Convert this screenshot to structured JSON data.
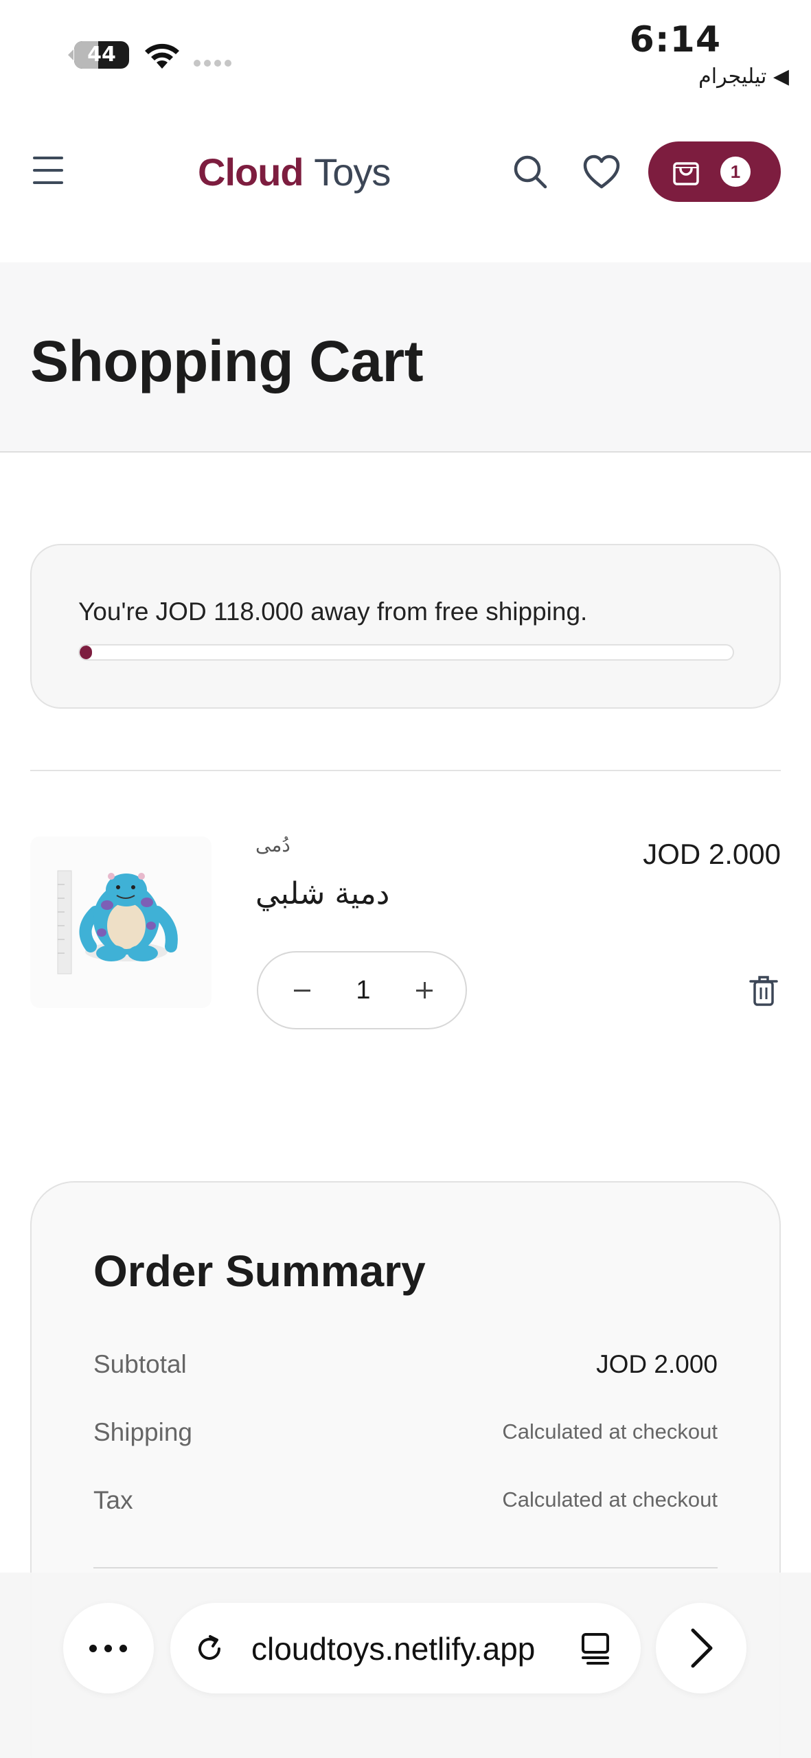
{
  "status_bar": {
    "battery": "44",
    "time": "6:14",
    "back_app": "◀ تيليجرام"
  },
  "header": {
    "logo_part1": "Cloud",
    "logo_part2": "Toys",
    "cart_count": "1",
    "brand_color": "#7d1d3f"
  },
  "page": {
    "title": "Shopping Cart"
  },
  "free_shipping": {
    "message": "You're JOD 118.000 away from free shipping.",
    "progress_fraction": 0.0167
  },
  "cart": {
    "items": [
      {
        "category": "دُمى",
        "name": "دمية شلبي",
        "price": "JOD 2.000",
        "quantity": "1",
        "image_icon": "plush-toy-image"
      }
    ]
  },
  "summary": {
    "title": "Order Summary",
    "subtotal_label": "Subtotal",
    "subtotal_value": "JOD 2.000",
    "shipping_label": "Shipping",
    "shipping_value": "Calculated at checkout",
    "tax_label": "Tax",
    "tax_value": "Calculated at checkout"
  },
  "browser": {
    "url": "cloudtoys.netlify.app",
    "icons": [
      "more-icon",
      "reload-icon",
      "reader-icon",
      "forward-icon"
    ]
  }
}
